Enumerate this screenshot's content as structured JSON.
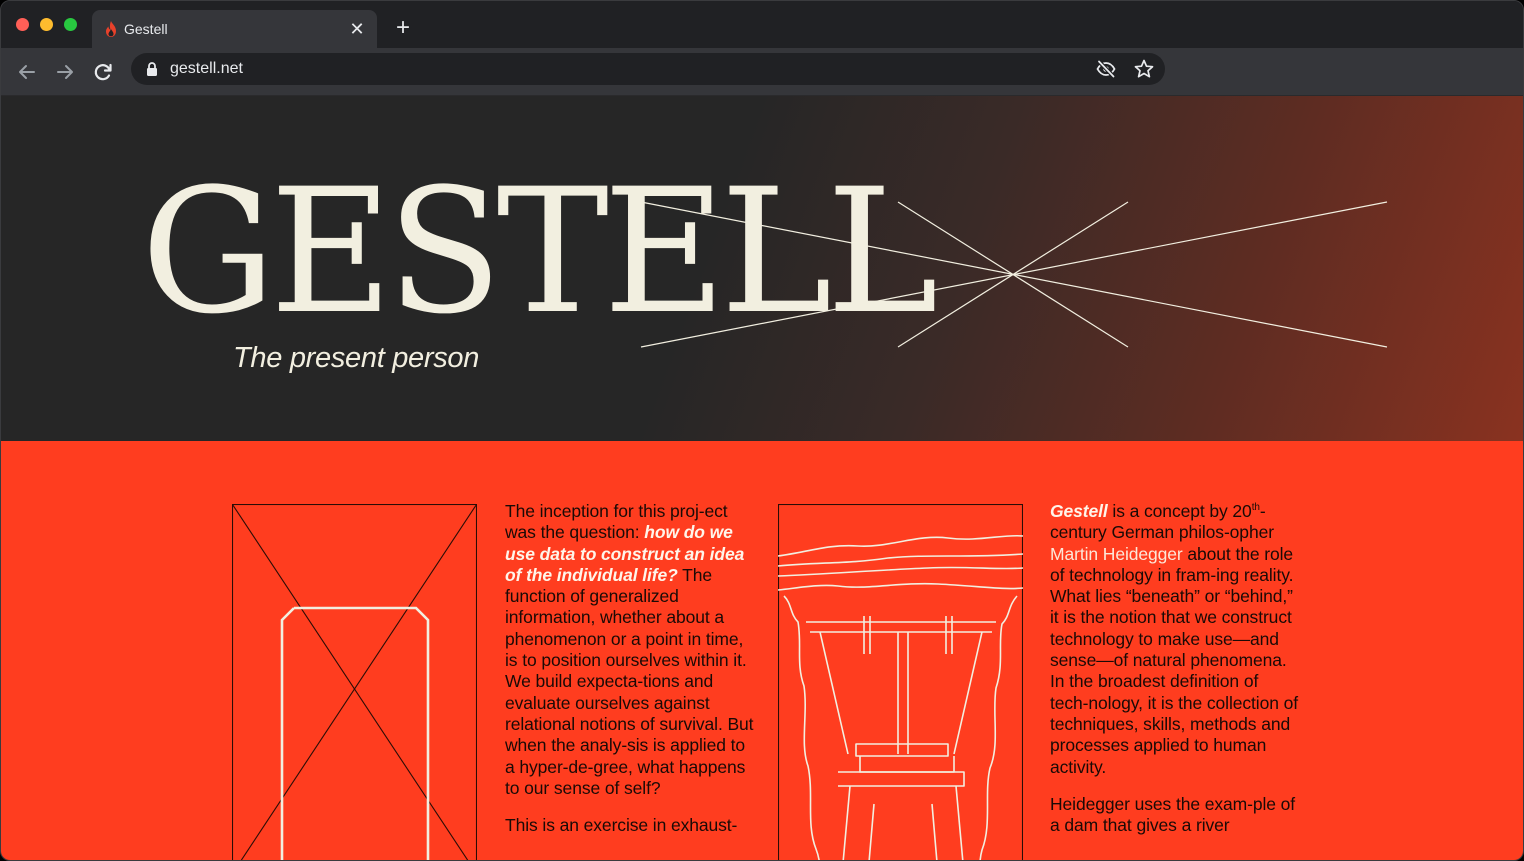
{
  "browser": {
    "tab_title": "Gestell",
    "tab_close": "✕",
    "new_tab": "+",
    "url": "gestell.net"
  },
  "hero": {
    "title": "GESTELL",
    "subtitle": "The present person"
  },
  "column1": {
    "p1_lead": "The inception for this proj-ect was the question: ",
    "p1_em": "how do we use data to construct an idea of the individual life?",
    "p1_rest": " The function of generalized information, whether about a phenomenon or a point in time, is to position ourselves within it. We build expecta-tions and evaluate ourselves against relational notions of survival. But when the analy-sis is applied to a hyper-de-gree, what happens to our sense of self?",
    "p2": "This is an exercise in exhaust-"
  },
  "column2": {
    "term": "Gestell",
    "p1_a": " is a concept by 20",
    "p1_sup": "th",
    "p1_b": "-century German philos-opher ",
    "link": "Martin Heidegger",
    "p1_c": " about the role of technology in fram-ing reality. What lies “beneath” or “behind,” it is the notion that we construct technology to make use—and sense—of natural phenomena. In the broadest definition of tech-nology, it is the collection of techniques, skills, methods and processes applied to human activity.",
    "p2": "Heidegger uses the exam-ple of a dam that gives a river"
  },
  "colors": {
    "hero_dark": "#262626",
    "hero_rust": "#8a3220",
    "content_red": "#ff3d1f",
    "cream": "#f2efe0"
  }
}
